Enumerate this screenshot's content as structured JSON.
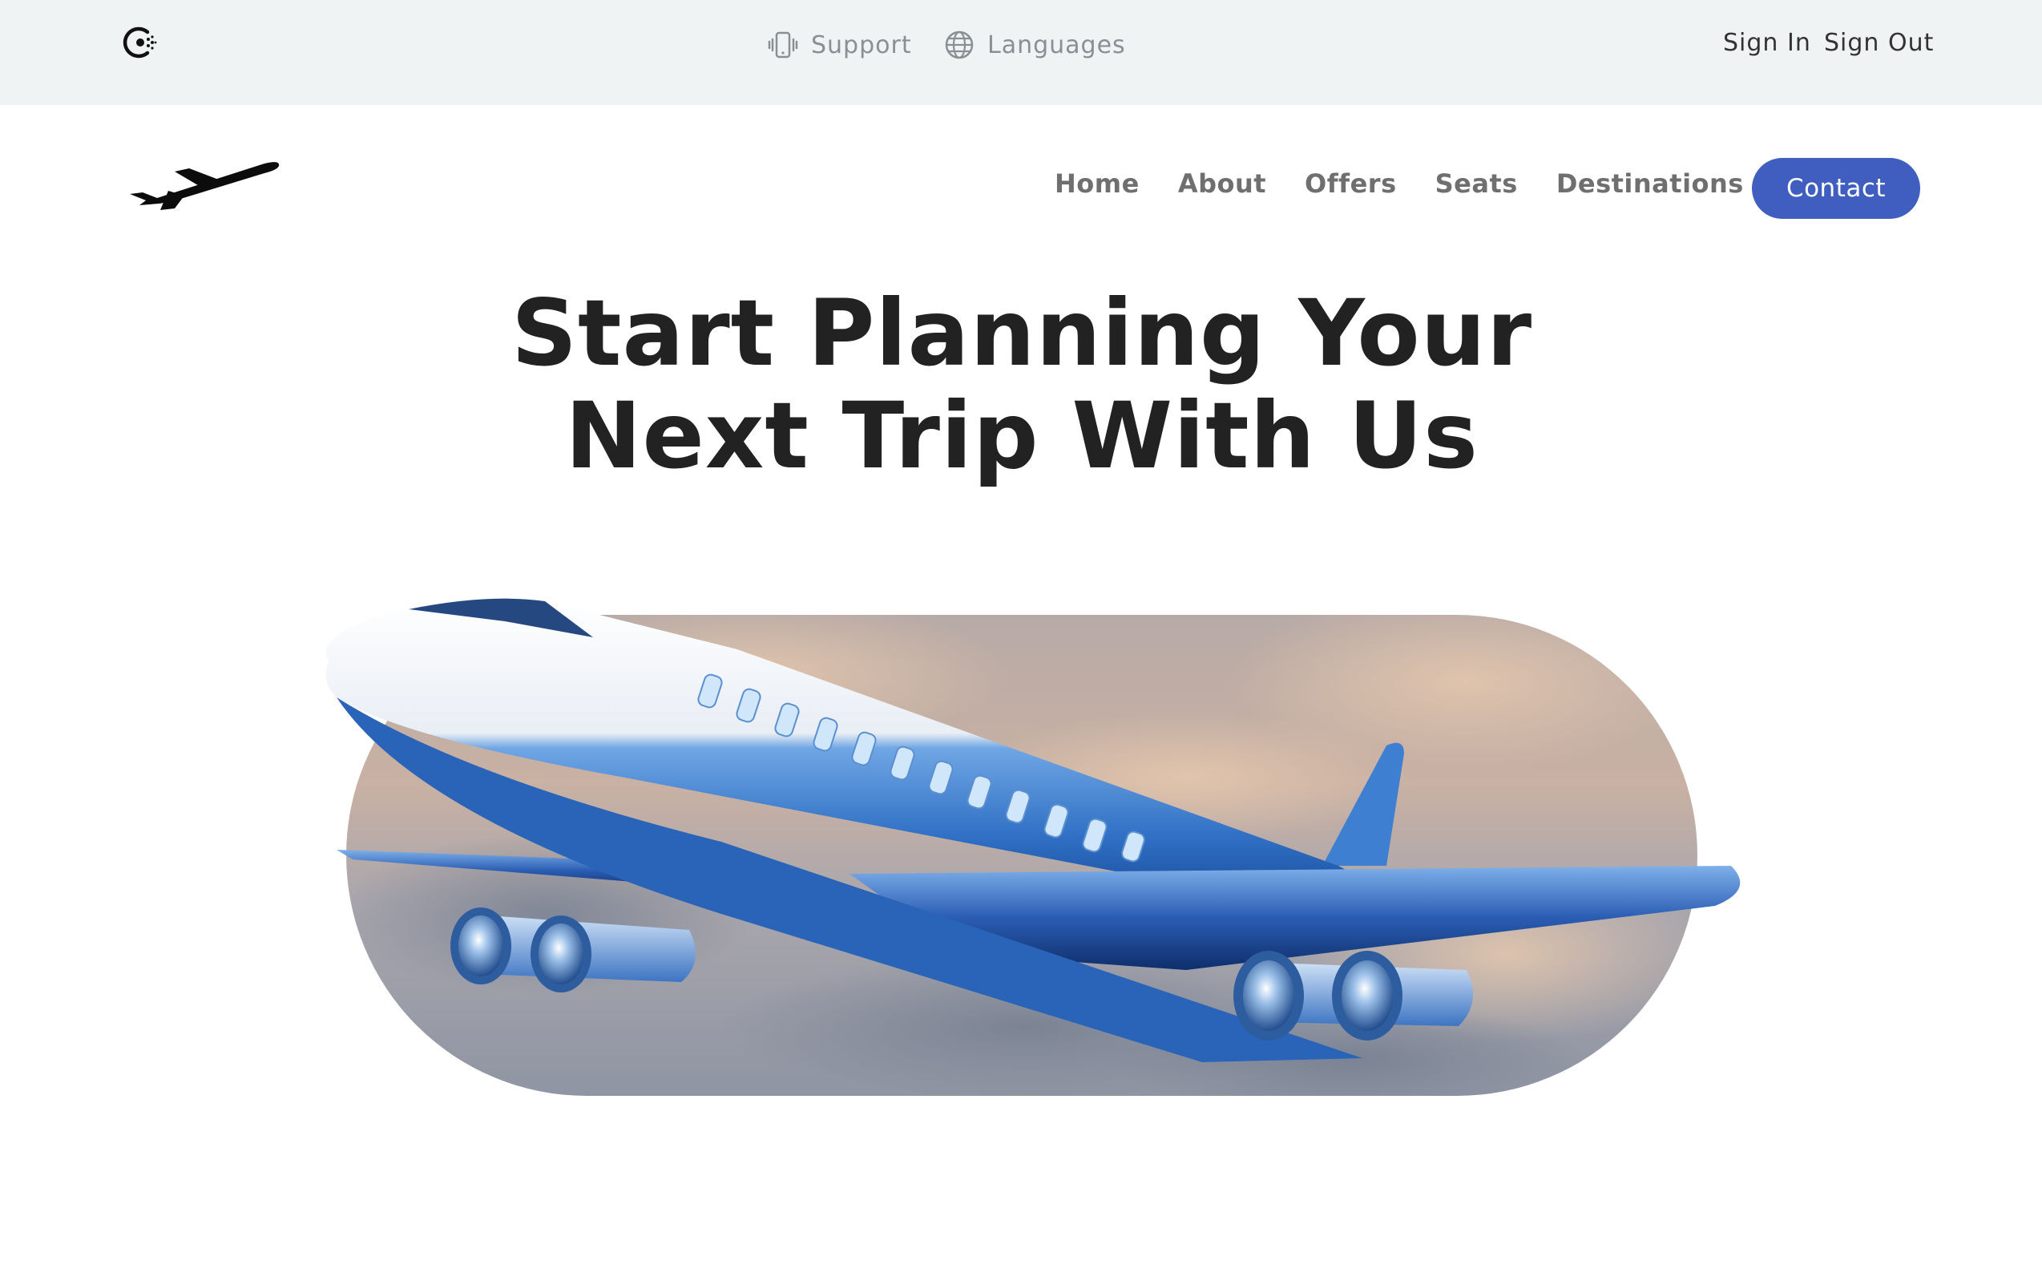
{
  "topbar": {
    "support_label": "Support",
    "languages_label": "Languages",
    "sign_in_label": "Sign In",
    "sign_out_label": "Sign Out",
    "icons": [
      "brand-logo-icon",
      "phone-vibrate-icon",
      "globe-icon"
    ]
  },
  "nav": {
    "items": [
      {
        "label": "Home"
      },
      {
        "label": "About"
      },
      {
        "label": "Offers"
      },
      {
        "label": "Seats"
      },
      {
        "label": "Destinations"
      }
    ],
    "contact_label": "Contact"
  },
  "hero": {
    "title_line1": "Start Planning Your",
    "title_line2": "Next Trip With Us"
  },
  "colors": {
    "topbar_bg": "#f0f3f4",
    "accent": "#3f5ebf",
    "heading": "#222222",
    "nav_text": "#6f6f6f",
    "plane_blue": "#2f6fc4"
  }
}
